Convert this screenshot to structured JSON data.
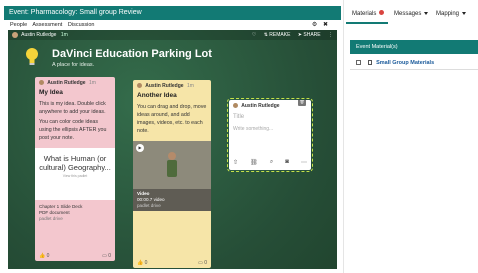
{
  "event": {
    "title": "Event: Pharmacology: Small group Review",
    "subnav": [
      "People",
      "Assessment",
      "Discussion"
    ]
  },
  "board": {
    "topbar": {
      "author": "Austin Rutledge",
      "time": "1m",
      "actions": [
        "♡",
        "⇅ REMAKE",
        "➤ SHARE",
        "⋮"
      ]
    },
    "title": "DaVinci Education Parking Lot",
    "subtitle": "A place for ideas."
  },
  "cards": {
    "pink": {
      "author": "Austin Rutledge",
      "time": "1m",
      "title": "My Idea",
      "body": "This is my idea. Double click anywhere to add your ideas.\nYou can color code ideas using the ellipsis AFTER you post your note.",
      "pdf_title": "What is Human (or cultural) Geography...",
      "pdf_sub": "View this padlet",
      "pdf_name": "Chapter 1 Slide Deck",
      "pdf_type": "PDF document",
      "pdf_source": "padlet drive",
      "likes": "0",
      "comments": "0"
    },
    "yellow": {
      "author": "Austin Rutledge",
      "time": "1m",
      "title": "Another Idea",
      "body": "You can drag and drop, move ideas around, and add images, videos, etc. to each note.",
      "video_label": "Video",
      "video_file": "00:00.7 video",
      "video_source": "padlet drive",
      "likes": "0",
      "comments": "0"
    },
    "new": {
      "author": "Austin Rutledge",
      "title_placeholder": "Title",
      "body_placeholder": "Write something..."
    }
  },
  "right": {
    "tabs": [
      "Materials",
      "Messages",
      "Mapping"
    ],
    "materials_header": "Event Material(s)",
    "material_item": "Small Group Materials"
  },
  "colors": {
    "accent": "#127a74",
    "board": "#2b5a3f",
    "pink": "#f3c7ce",
    "yellow": "#f6e5a8",
    "highlight": "#c6e24a"
  }
}
